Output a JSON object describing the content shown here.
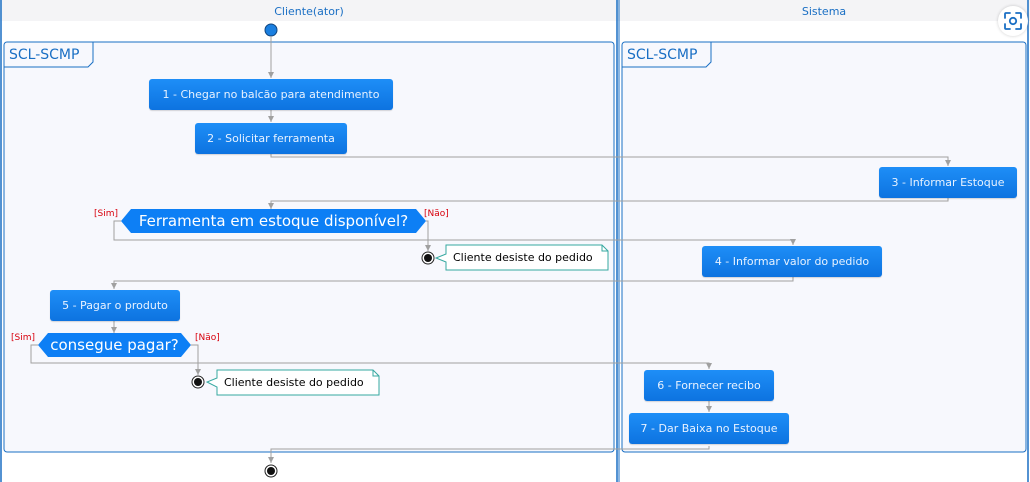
{
  "lanes": [
    {
      "title": "Cliente(ator)"
    },
    {
      "title": "Sistema"
    }
  ],
  "frames": [
    {
      "label": "SCL-SCMP"
    },
    {
      "label": "SCL-SCMP"
    }
  ],
  "actions": {
    "a1": "1 - Chegar no balcão para atendimento",
    "a2": "2 - Solicitar ferramenta",
    "a3": "3 - Informar Estoque",
    "a4": "4 - Informar valor do pedido",
    "a5": "5 - Pagar o produto",
    "a6": "6 - Fornecer recibo",
    "a7": "7 - Dar Baixa no Estoque"
  },
  "decisions": {
    "d1": {
      "text": "Ferramenta em estoque disponível?",
      "yes": "[Sim]",
      "no": "[Não]"
    },
    "d2": {
      "text": "consegue pagar?",
      "yes": "[Sim]",
      "no": "[Não]"
    }
  },
  "notes": {
    "n1": "Cliente desiste do pedido",
    "n2": "Cliente desiste do pedido"
  },
  "icons": {
    "corner": "focus-scan-icon"
  },
  "colors": {
    "accent": "#1a6fc4",
    "action_fill": "#1282f0",
    "arrow": "#a0a0a0",
    "guard": "#d8000c",
    "note_border": "#36a8a0"
  }
}
